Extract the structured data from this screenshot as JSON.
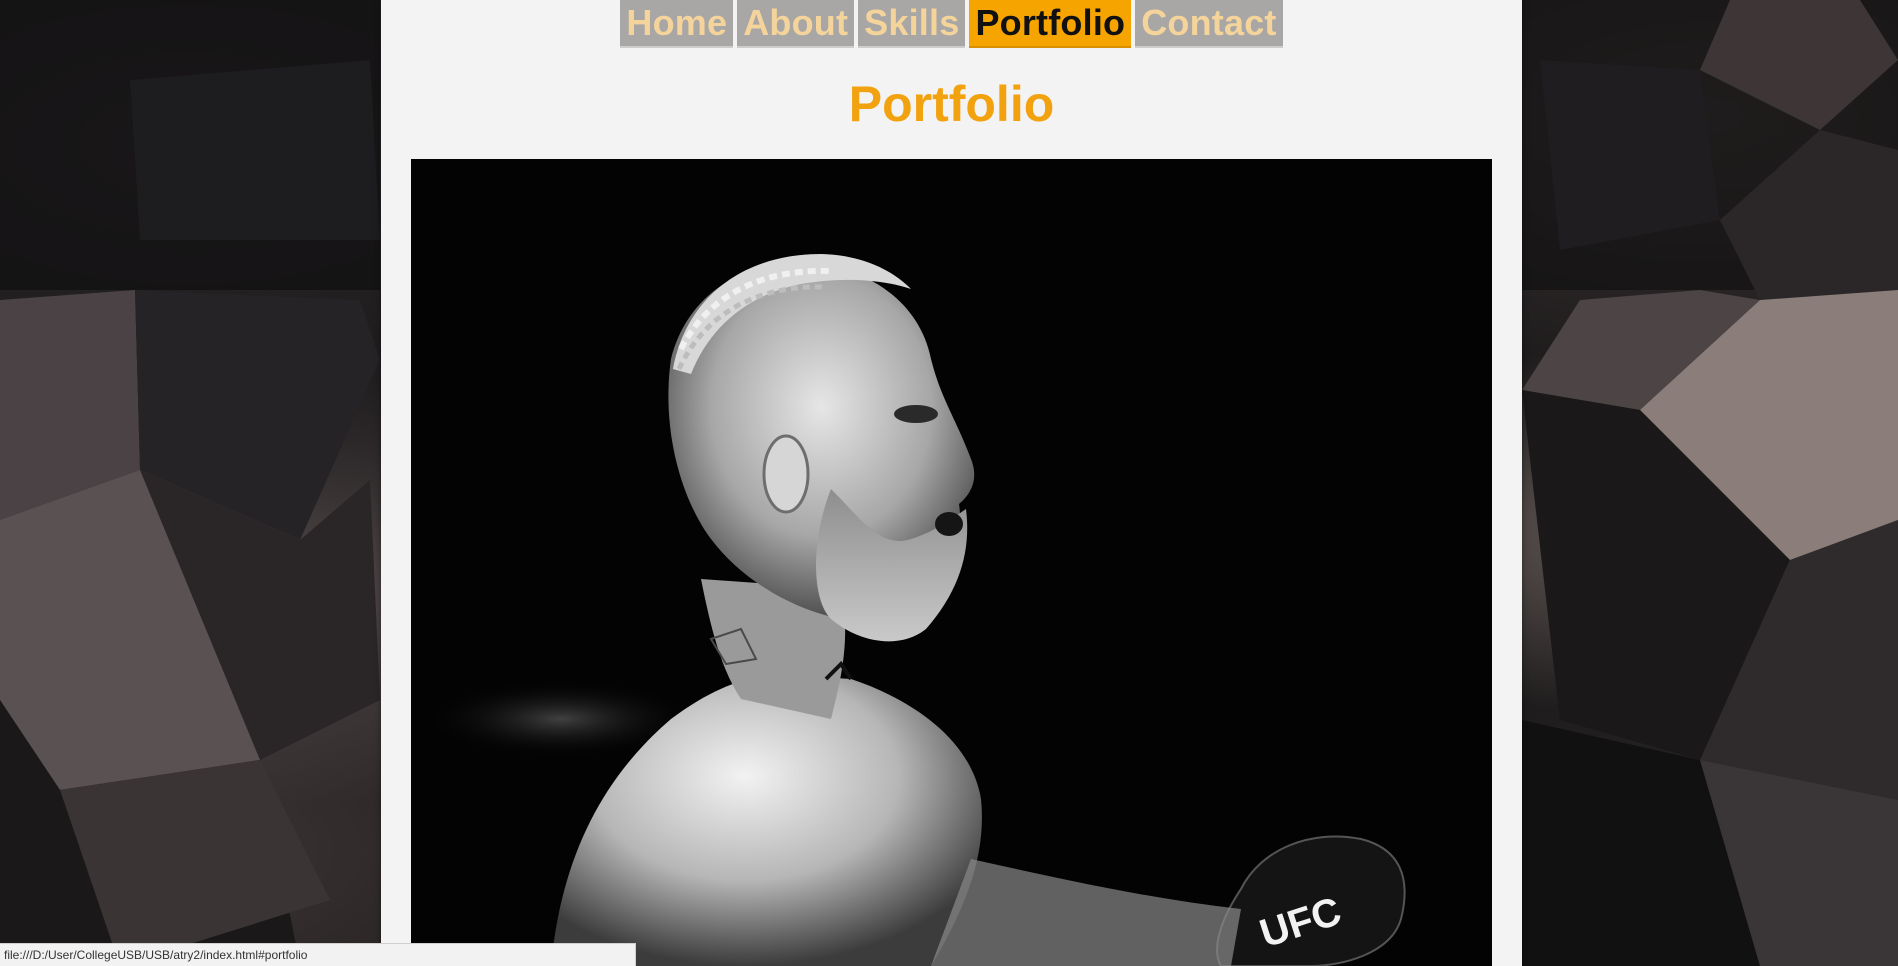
{
  "nav": {
    "items": [
      {
        "label": "Home",
        "active": false
      },
      {
        "label": "About",
        "active": false
      },
      {
        "label": "Skills",
        "active": false
      },
      {
        "label": "Portfolio",
        "active": true
      },
      {
        "label": "Contact",
        "active": false
      }
    ]
  },
  "page": {
    "title": "Portfolio"
  },
  "portfolio": {
    "image_subject": "fighter-portrait",
    "glove_text": "UFC"
  },
  "status_bar": {
    "url": "file:///D:/User/CollegeUSB/USB/atry2/index.html#portfolio"
  },
  "colors": {
    "accent": "#f6a400",
    "title": "#f2a20e",
    "nav_bg": "#a9a7a5",
    "nav_text": "#f4d49b",
    "panel_bg": "#f3f3f3"
  }
}
